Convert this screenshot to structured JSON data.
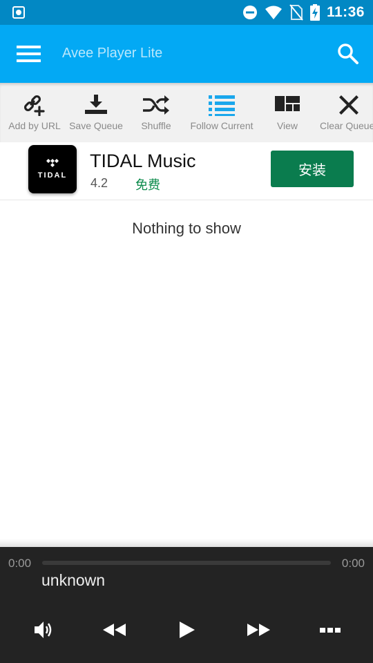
{
  "status_bar": {
    "time": "11:36",
    "icons": [
      "screenshot-notification-icon",
      "do-not-disturb-icon",
      "wifi-icon",
      "no-sim-icon",
      "battery-charging-icon"
    ]
  },
  "app_bar": {
    "title": "Avee Player Lite",
    "menu_icon": "hamburger-menu-icon",
    "search_icon": "search-icon",
    "color": "#03a9f4"
  },
  "toolbar": {
    "items": [
      {
        "label": "Add by URL",
        "icon": "link-add-icon"
      },
      {
        "label": "Save Queue",
        "icon": "download-icon"
      },
      {
        "label": "Shuffle",
        "icon": "shuffle-icon"
      },
      {
        "label": "Follow Current",
        "icon": "list-icon",
        "active": true
      },
      {
        "label": "View",
        "icon": "view-grid-icon"
      },
      {
        "label": "Clear Queue",
        "icon": "close-icon"
      }
    ],
    "active_color": "#1aa7ec"
  },
  "ad": {
    "app_name": "TIDAL Music",
    "logo_text": "TIDAL",
    "rating": "4.2",
    "price": "免费",
    "install_label": "安装",
    "install_color": "#0a7c4e"
  },
  "queue": {
    "empty_text": "Nothing to show"
  },
  "player": {
    "time_current": "0:00",
    "time_total": "0:00",
    "progress": 0,
    "track_title": "unknown",
    "controls": [
      "volume-icon",
      "rewind-icon",
      "play-icon",
      "fast-forward-icon",
      "more-options-icon"
    ]
  }
}
